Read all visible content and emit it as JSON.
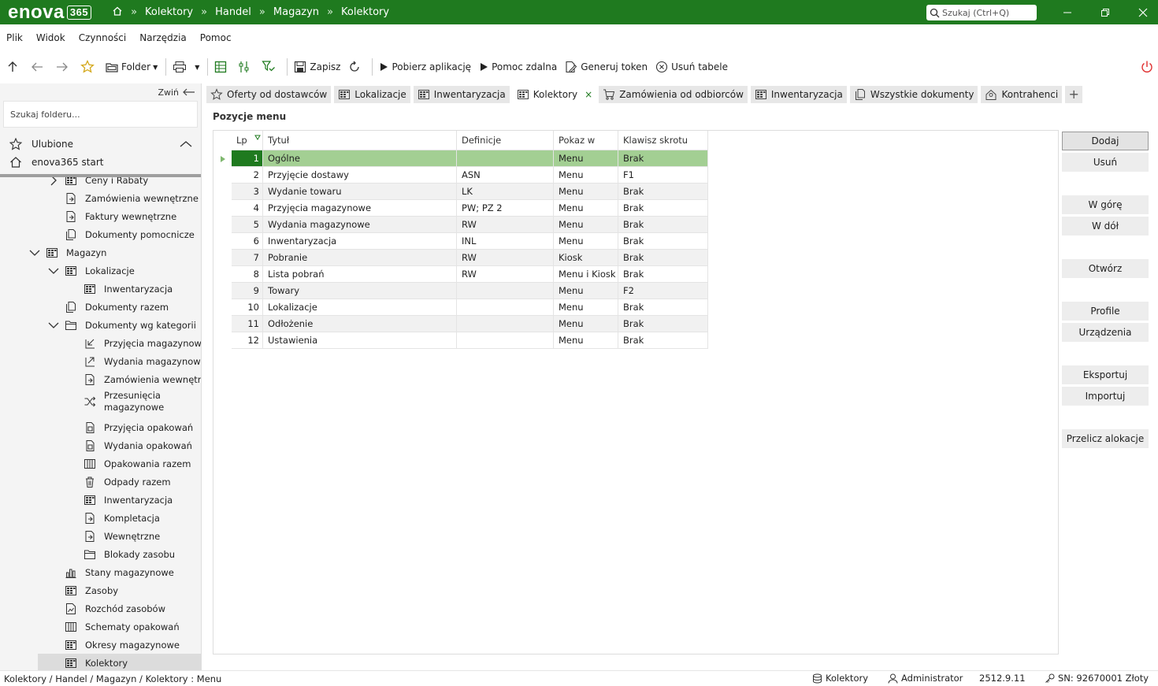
{
  "app": {
    "logo_text": "enova",
    "logo_version": "365",
    "breadcrumbs": [
      "Kolektory",
      "Handel",
      "Magazyn",
      "Kolektory"
    ],
    "breadcrumb_sep": "»",
    "search_placeholder": "Szukaj (Ctrl+Q)"
  },
  "menu": [
    "Plik",
    "Widok",
    "Czynności",
    "Narzędzia",
    "Pomoc"
  ],
  "toolbar": {
    "folder_label": "Folder",
    "save_label": "Zapisz",
    "download_app_label": "Pobierz aplikację",
    "remote_help_label": "Pomoc zdalna",
    "generate_token_label": "Generuj token",
    "delete_tables_label": "Usuń tabele"
  },
  "sidebar": {
    "collapse_label": "Zwiń",
    "search_placeholder": "Szukaj folderu...",
    "favorites_label": "Ulubione",
    "start_label": "enova365 start",
    "items": [
      {
        "label": "Ceny i Rabaty",
        "depth": 1,
        "chevron": "right",
        "icon": "grid"
      },
      {
        "label": "Zamówienia wewnętrzne",
        "depth": 1,
        "chevron": "",
        "icon": "doc"
      },
      {
        "label": "Faktury wewnętrzne",
        "depth": 1,
        "chevron": "",
        "icon": "doc"
      },
      {
        "label": "Dokumenty pomocnicze",
        "depth": 1,
        "chevron": "",
        "icon": "docs"
      },
      {
        "label": "Magazyn",
        "depth": 0,
        "chevron": "down",
        "icon": "grid"
      },
      {
        "label": "Lokalizacje",
        "depth": 1,
        "chevron": "down",
        "icon": "grid"
      },
      {
        "label": "Inwentaryzacja",
        "depth": 2,
        "chevron": "",
        "icon": "grid"
      },
      {
        "label": "Dokumenty razem",
        "depth": 1,
        "chevron": "",
        "icon": "docs"
      },
      {
        "label": "Dokumenty wg kategorii",
        "depth": 1,
        "chevron": "down",
        "icon": "folder"
      },
      {
        "label": "Przyjęcia magazynowe",
        "depth": 2,
        "chevron": "",
        "icon": "in"
      },
      {
        "label": "Wydania magazynowe",
        "depth": 2,
        "chevron": "",
        "icon": "out"
      },
      {
        "label": "Zamówienia wewnętrzr",
        "depth": 2,
        "chevron": "",
        "icon": "doc"
      },
      {
        "label": "Przesunięcia",
        "label2": "magazynowe",
        "depth": 2,
        "chevron": "",
        "icon": "shuffle"
      },
      {
        "label": "Przyjęcia opakowań",
        "depth": 2,
        "chevron": "",
        "icon": "box"
      },
      {
        "label": "Wydania opakowań",
        "depth": 2,
        "chevron": "",
        "icon": "box"
      },
      {
        "label": "Opakowania razem",
        "depth": 2,
        "chevron": "",
        "icon": "boxes"
      },
      {
        "label": "Odpady razem",
        "depth": 2,
        "chevron": "",
        "icon": "trash"
      },
      {
        "label": "Inwentaryzacja",
        "depth": 2,
        "chevron": "",
        "icon": "grid"
      },
      {
        "label": "Kompletacja",
        "depth": 2,
        "chevron": "",
        "icon": "doc"
      },
      {
        "label": "Wewnętrzne",
        "depth": 2,
        "chevron": "",
        "icon": "doc"
      },
      {
        "label": "Blokady zasobu",
        "depth": 2,
        "chevron": "",
        "icon": "folder"
      },
      {
        "label": "Stany magazynowe",
        "depth": 1,
        "chevron": "",
        "icon": "chart"
      },
      {
        "label": "Zasoby",
        "depth": 1,
        "chevron": "",
        "icon": "grid"
      },
      {
        "label": "Rozchód zasobów",
        "depth": 1,
        "chevron": "",
        "icon": "chartdoc"
      },
      {
        "label": "Schematy opakowań",
        "depth": 1,
        "chevron": "",
        "icon": "boxes"
      },
      {
        "label": "Okresy magazynowe",
        "depth": 1,
        "chevron": "",
        "icon": "grid"
      },
      {
        "label": "Kolektory",
        "depth": 1,
        "chevron": "",
        "icon": "grid",
        "selected": true
      }
    ]
  },
  "tabs": [
    {
      "label": "Oferty od dostawców",
      "icon": "star"
    },
    {
      "label": "Lokalizacje",
      "icon": "grid"
    },
    {
      "label": "Inwentaryzacja",
      "icon": "grid"
    },
    {
      "label": "Kolektory",
      "icon": "grid",
      "active": true
    },
    {
      "label": "Zamówienia od odbiorców",
      "icon": "cart"
    },
    {
      "label": "Inwentaryzacja",
      "icon": "grid"
    },
    {
      "label": "Wszystkie dokumenty",
      "icon": "docs"
    },
    {
      "label": "Kontrahenci",
      "icon": "person"
    }
  ],
  "tab_close": "×",
  "tab_add": "+",
  "content": {
    "section_title": "Pozycje menu",
    "columns": [
      "Lp",
      "Tytuł",
      "Definicje",
      "Pokaz w",
      "Klawisz skrotu"
    ],
    "rows": [
      {
        "lp": "1",
        "title": "Ogólne",
        "def": "",
        "show": "Menu",
        "key": "Brak",
        "selected": true
      },
      {
        "lp": "2",
        "title": "Przyjęcie dostawy",
        "def": "ASN",
        "show": "Menu",
        "key": "F1"
      },
      {
        "lp": "3",
        "title": "Wydanie towaru",
        "def": "LK",
        "show": "Menu",
        "key": "Brak"
      },
      {
        "lp": "4",
        "title": "Przyjęcia magazynowe",
        "def": "PW; PZ 2",
        "show": "Menu",
        "key": "Brak"
      },
      {
        "lp": "5",
        "title": "Wydania magazynowe",
        "def": "RW",
        "show": "Menu",
        "key": "Brak"
      },
      {
        "lp": "6",
        "title": "Inwentaryzacja",
        "def": "INL",
        "show": "Menu",
        "key": "Brak"
      },
      {
        "lp": "7",
        "title": "Pobranie",
        "def": "RW",
        "show": "Kiosk",
        "key": "Brak"
      },
      {
        "lp": "8",
        "title": "Lista pobrań",
        "def": "RW",
        "show": "Menu i Kiosk",
        "key": "Brak"
      },
      {
        "lp": "9",
        "title": "Towary",
        "def": "",
        "show": "Menu",
        "key": "F2"
      },
      {
        "lp": "10",
        "title": "Lokalizacje",
        "def": "",
        "show": "Menu",
        "key": "Brak"
      },
      {
        "lp": "11",
        "title": "Odłożenie",
        "def": "",
        "show": "Menu",
        "key": "Brak"
      },
      {
        "lp": "12",
        "title": "Ustawienia",
        "def": "",
        "show": "Menu",
        "key": "Brak"
      }
    ]
  },
  "actions": {
    "add": "Dodaj",
    "remove": "Usuń",
    "up": "W górę",
    "down": "W dół",
    "open": "Otwórz",
    "profiles": "Profile",
    "devices": "Urządzenia",
    "export": "Eksportuj",
    "import": "Importuj",
    "recalc": "Przelicz alokacje"
  },
  "status": {
    "path": "Kolektory / Handel / Magazyn / Kolektory : Menu",
    "database": "Kolektory",
    "user": "Administrator",
    "version": "2512.9.11",
    "serial": "SN: 92670001 Złoty"
  },
  "colors": {
    "brand": "#1f7a1f",
    "selected_row": "#a3cf93"
  }
}
